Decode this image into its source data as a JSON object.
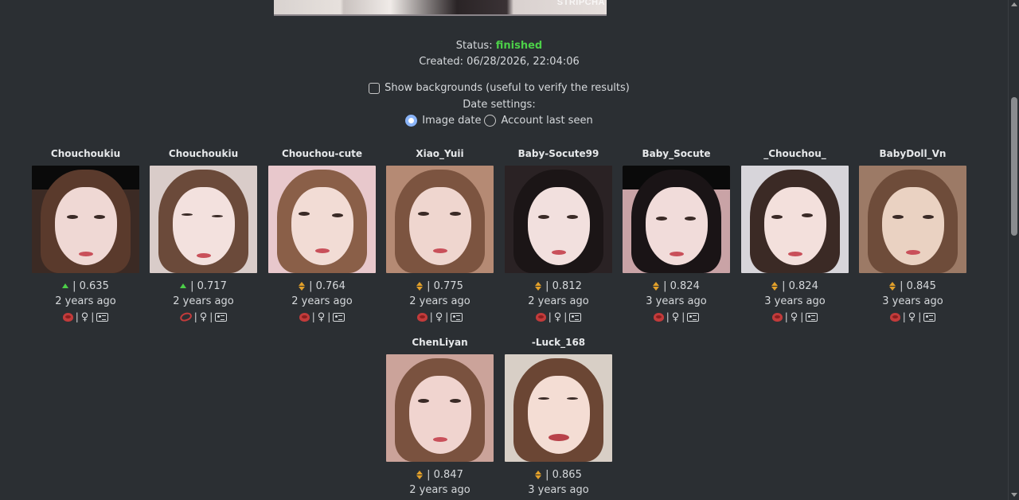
{
  "top_image": {
    "watermark": "STRIPCHA"
  },
  "status": {
    "label": "Status:",
    "value": "finished",
    "value_color": "#4ccf48"
  },
  "created": "Created: 06/28/2026, 22:04:06",
  "show_backgrounds": {
    "label": "Show backgrounds (useful to verify the results)",
    "checked": false
  },
  "date_settings": {
    "label": "Date settings:",
    "options": [
      {
        "label": "Image date",
        "selected": true
      },
      {
        "label": "Account last seen",
        "selected": false
      }
    ]
  },
  "results": [
    {
      "name": "Chouchoukiu",
      "trend": "up",
      "score": "| 0.635",
      "ago": "2 years ago",
      "source": "default"
    },
    {
      "name": "Chouchoukiu",
      "trend": "up",
      "score": "| 0.717",
      "ago": "2 years ago",
      "source": "alt"
    },
    {
      "name": "Chouchou-cute",
      "trend": "updown",
      "score": "| 0.764",
      "ago": "2 years ago",
      "source": "default"
    },
    {
      "name": "Xiao_Yuii",
      "trend": "updown",
      "score": "| 0.775",
      "ago": "2 years ago",
      "source": "default"
    },
    {
      "name": "Baby-Socute99",
      "trend": "updown",
      "score": "| 0.812",
      "ago": "2 years ago",
      "source": "default"
    },
    {
      "name": "Baby_Socute",
      "trend": "updown",
      "score": "| 0.824",
      "ago": "3 years ago",
      "source": "default"
    },
    {
      "name": "_Chouchou_",
      "trend": "updown",
      "score": "| 0.824",
      "ago": "3 years ago",
      "source": "default"
    },
    {
      "name": "BabyDoll_Vn",
      "trend": "updown",
      "score": "| 0.845",
      "ago": "3 years ago",
      "source": "default"
    },
    {
      "name": "ChenLiyan",
      "trend": "updown",
      "score": "| 0.847",
      "ago": "2 years ago",
      "source": "default"
    },
    {
      "name": "-Luck_168",
      "trend": "updown",
      "score": "| 0.865",
      "ago": "3 years ago",
      "source": "default"
    }
  ],
  "icon_separators": "|",
  "female_symbol": "♀"
}
